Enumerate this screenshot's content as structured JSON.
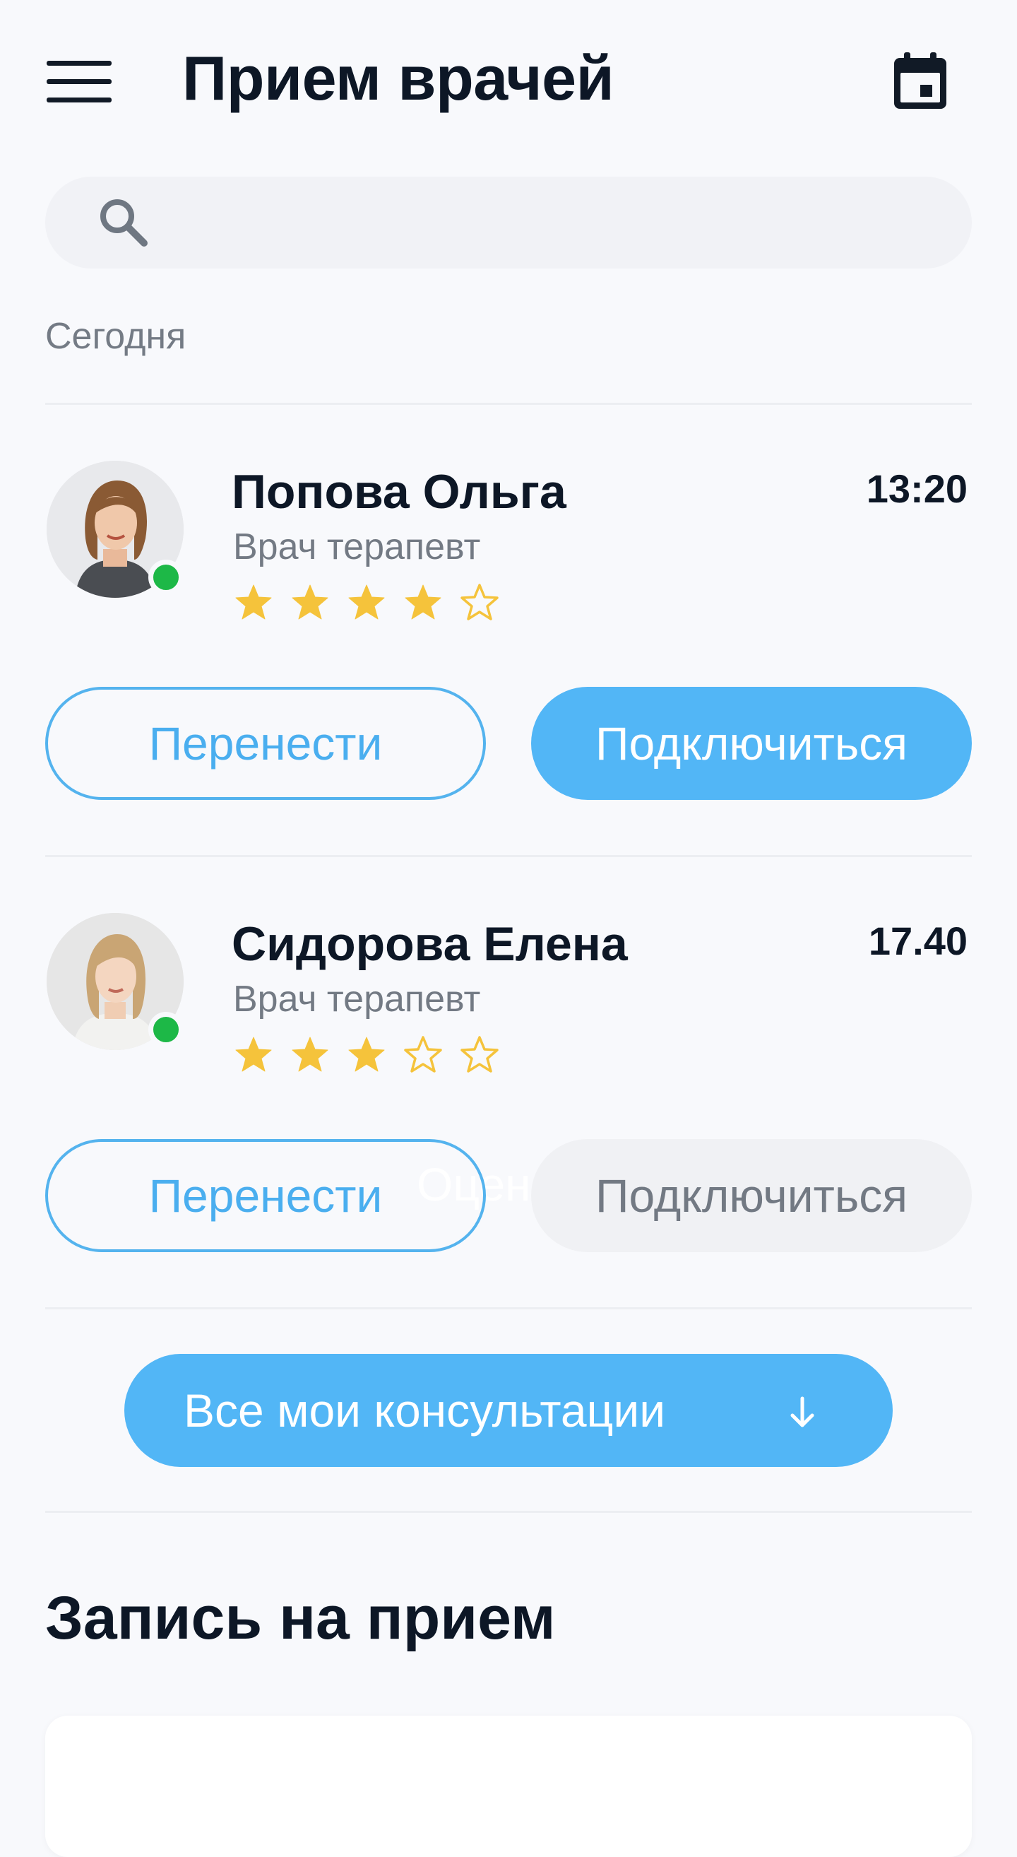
{
  "header": {
    "title": "Прием врачей",
    "menu_icon": "hamburger-menu-icon",
    "calendar_icon": "calendar-icon"
  },
  "search": {
    "placeholder": "",
    "value": "",
    "icon": "search-icon"
  },
  "section_label": "Сегодня",
  "appointments": [
    {
      "name": "Попова Ольга",
      "specialty": "Врач терапевт",
      "time": "13:20",
      "rating": 4,
      "max_rating": 5,
      "online": true,
      "reschedule_label": "Перенести",
      "connect_label": "Подключиться",
      "connect_enabled": true
    },
    {
      "name": "Сидорова Елена",
      "specialty": "Врач терапевт",
      "time": "17.40",
      "rating": 3,
      "max_rating": 5,
      "online": true,
      "reschedule_label": "Перенести",
      "connect_label": "Подключиться",
      "connect_enabled": false,
      "overlapped_text": "Оцен"
    }
  ],
  "all_consultations_label": "Все мои консультации",
  "booking_section_title": "Запись на прием",
  "colors": {
    "accent": "#52b6f6",
    "star": "#f5c33b",
    "online": "#1db847",
    "text": "#0d1726",
    "muted": "#737a84"
  }
}
